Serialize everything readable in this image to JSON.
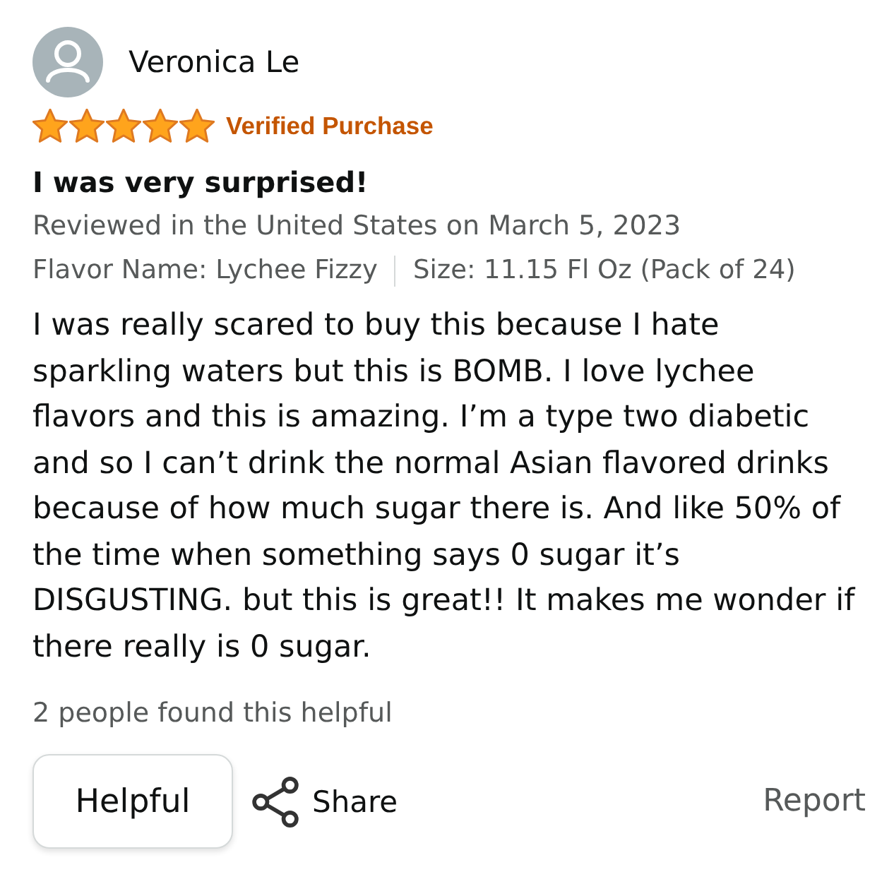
{
  "reviewer": {
    "name": "Veronica Le"
  },
  "rating": {
    "stars": 5,
    "badge": "Verified Purchase"
  },
  "review": {
    "title": "I was very surprised!",
    "date_line": "Reviewed in the United States on March 5, 2023",
    "variants": [
      "Flavor Name: Lychee Fizzy",
      "Size: 11.15 Fl Oz (Pack of 24)"
    ],
    "body": "I was really scared to buy this because I hate sparkling waters but this is BOMB. I love lychee flavors and this is amazing. I’m a type two diabetic and so I can’t drink the normal Asian flavored drinks because of how much sugar there is. And like 50% of the time when something says 0 sugar it’s DISGUSTING. but this is great!! It makes me wonder if there really is 0 sugar."
  },
  "helpful_count": "2 people found this helpful",
  "actions": [
    {
      "kind": "helpful",
      "label": "Helpful"
    },
    {
      "kind": "share",
      "label": "Share"
    },
    {
      "kind": "report",
      "label": "Report"
    }
  ]
}
